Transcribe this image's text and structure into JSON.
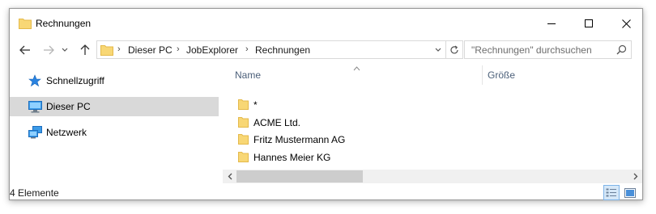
{
  "window": {
    "title": "Rechnungen",
    "buttons": {
      "minimize": "minimize",
      "maximize": "maximize",
      "close": "close"
    }
  },
  "nav": {
    "back": "back-arrow",
    "forward": "forward-arrow",
    "recent": "recent-locations-chevron",
    "up": "up-arrow"
  },
  "address": {
    "crumbs": [
      "Dieser PC",
      "JobExplorer",
      "Rechnungen"
    ]
  },
  "search": {
    "placeholder": "\"Rechnungen\" durchsuchen"
  },
  "sidebar": {
    "items": [
      {
        "label": "Schnellzugriff",
        "icon": "star-icon",
        "selected": false
      },
      {
        "label": "Dieser PC",
        "icon": "computer-icon",
        "selected": true
      },
      {
        "label": "Netzwerk",
        "icon": "network-icon",
        "selected": false
      }
    ]
  },
  "columns": {
    "name": "Name",
    "size": "Größe"
  },
  "files": [
    {
      "name": "*"
    },
    {
      "name": "ACME Ltd."
    },
    {
      "name": "Fritz Mustermann AG"
    },
    {
      "name": "Hannes Meier KG"
    }
  ],
  "status": {
    "count": "4 Elemente"
  },
  "colors": {
    "folder": "#f8d775",
    "folder_dark": "#e4b94a",
    "selected_bg": "#d9d9d9",
    "accent_blue": "#1e7ad6"
  }
}
